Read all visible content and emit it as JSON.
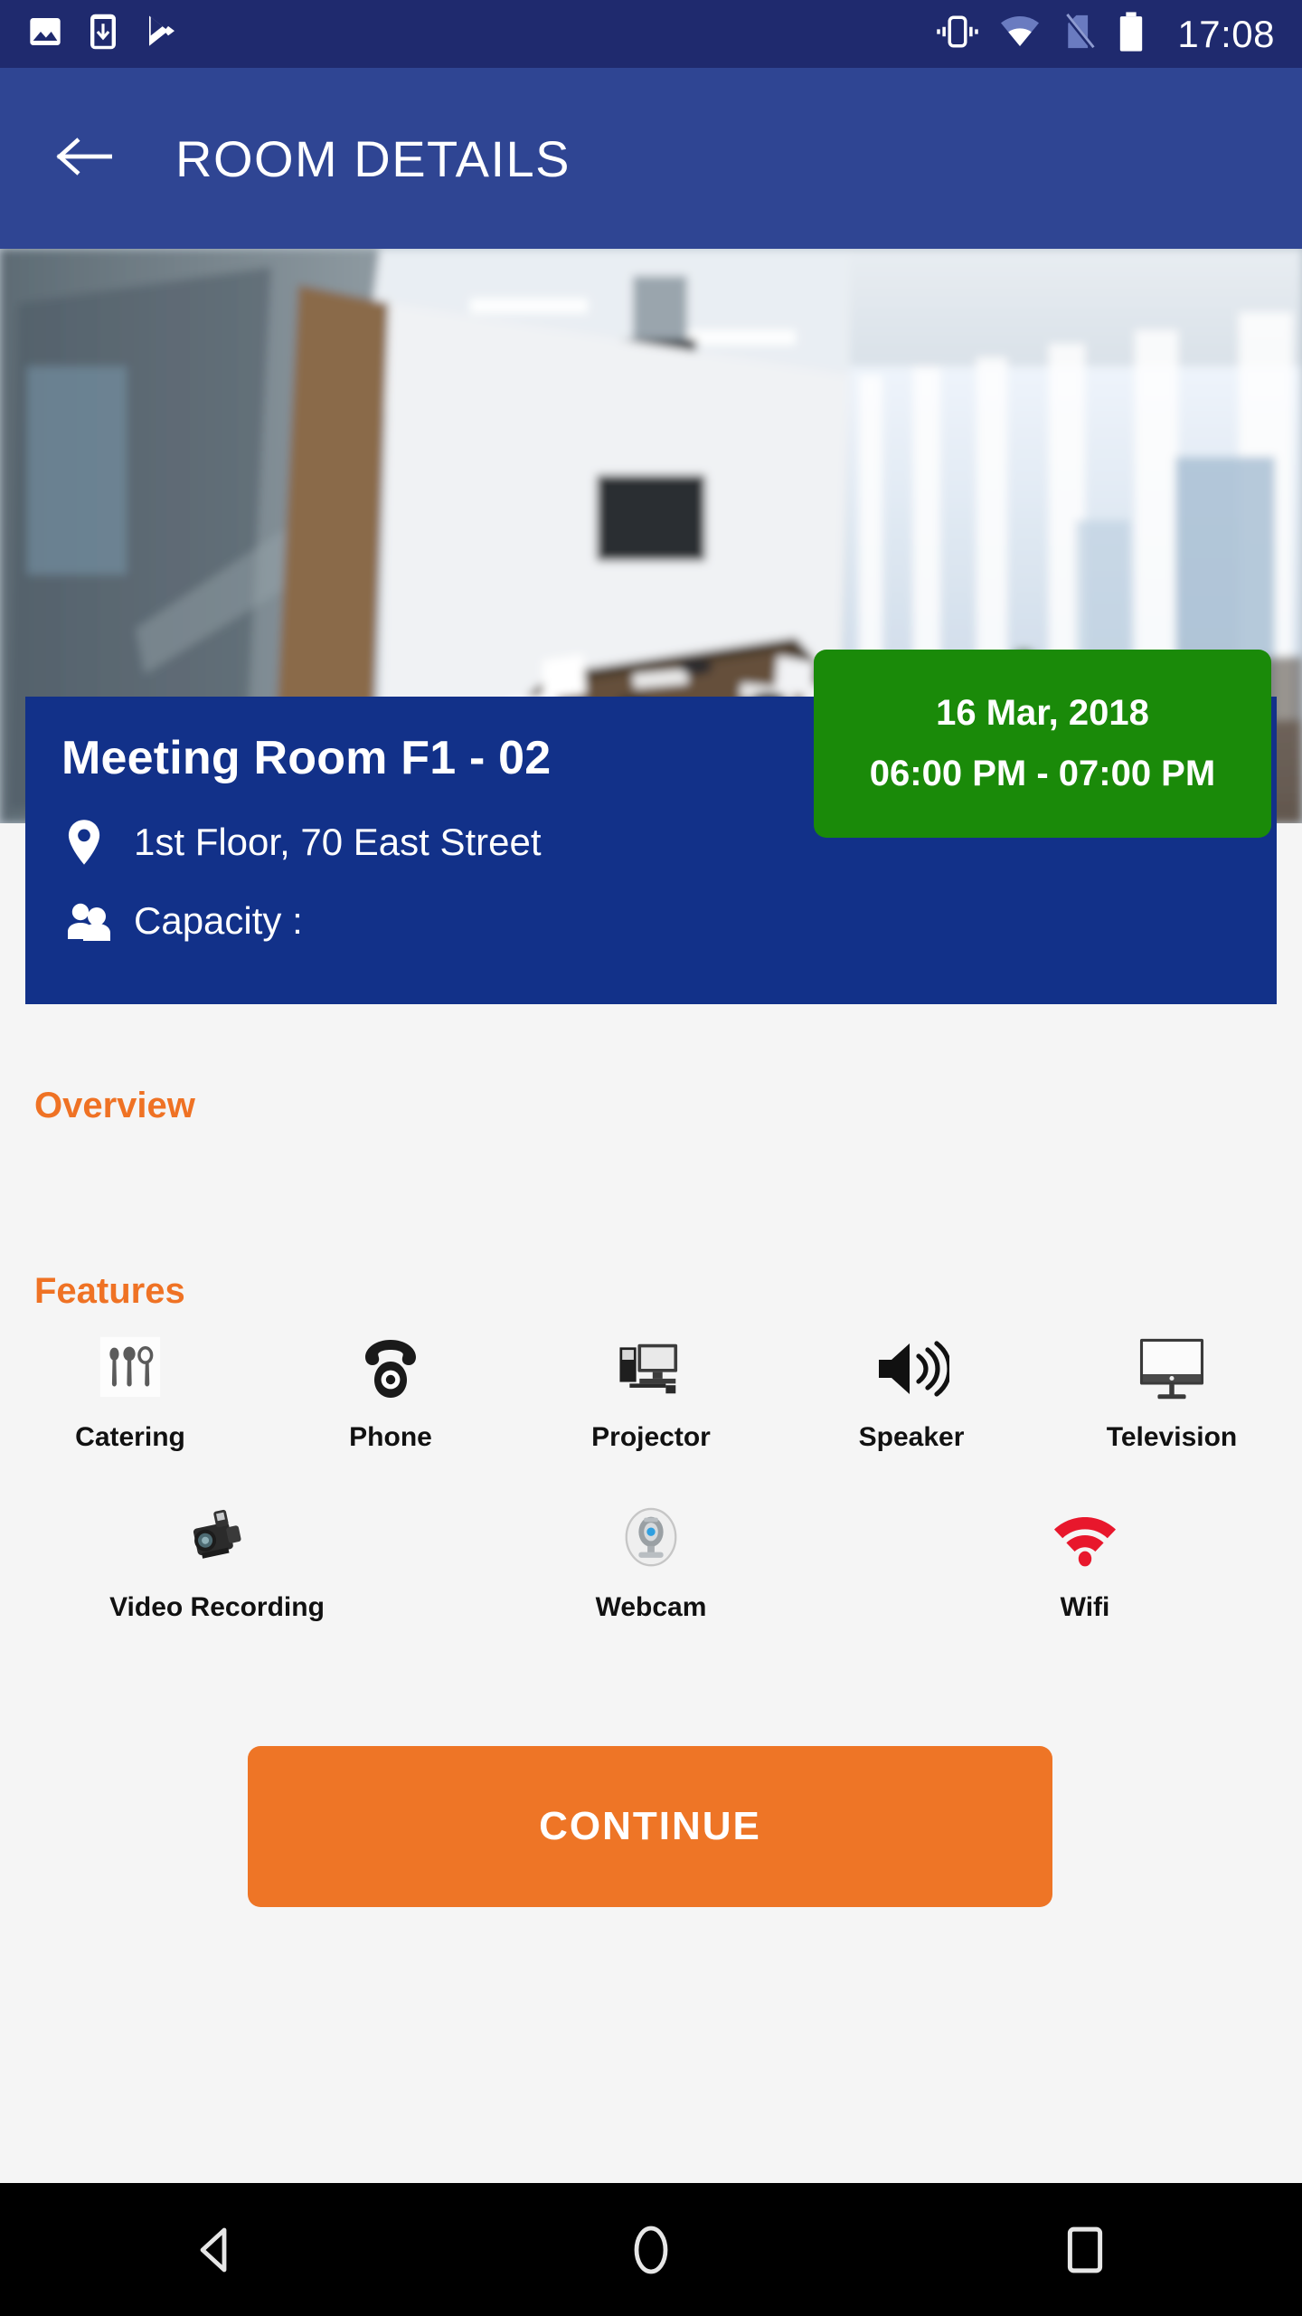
{
  "statusbar": {
    "time": "17:08",
    "left_icons": [
      "image-icon",
      "download-icon",
      "play-store-icon"
    ],
    "right_icons": [
      "vibrate-icon",
      "wifi-icon",
      "no-sim-icon",
      "battery-icon"
    ],
    "background_color": "#1f2a6e"
  },
  "appbar": {
    "back_label": "back-arrow",
    "title": "ROOM DETAILS",
    "background_color": "#2f4593"
  },
  "hero": {
    "alt": "meeting room photo"
  },
  "room": {
    "name": "Meeting Room F1 - 02",
    "location": "1st Floor, 70 East Street",
    "capacity_label": "Capacity :",
    "capacity_value": "",
    "card_color": "#123189"
  },
  "booking": {
    "date": "16 Mar, 2018",
    "time_range": "06:00 PM - 07:00 PM",
    "badge_color": "#1a8a09"
  },
  "sections": {
    "overview_title": "Overview",
    "overview_body": "",
    "features_title": "Features",
    "accent_color": "#ef7224"
  },
  "features": {
    "row1": [
      {
        "label": "Catering",
        "icon": "catering-icon"
      },
      {
        "label": "Phone",
        "icon": "phone-icon"
      },
      {
        "label": "Projector",
        "icon": "projector-icon"
      },
      {
        "label": "Speaker",
        "icon": "speaker-icon"
      },
      {
        "label": "Television",
        "icon": "television-icon"
      }
    ],
    "row2": [
      {
        "label": "Video Recording",
        "icon": "video-camera-icon"
      },
      {
        "label": "Webcam",
        "icon": "webcam-icon"
      },
      {
        "label": "Wifi",
        "icon": "wifi-icon"
      }
    ]
  },
  "actions": {
    "continue_label": "CONTINUE",
    "continue_color": "#ee7526"
  },
  "navbar": {
    "back": "nav-back-icon",
    "home": "nav-home-icon",
    "recents": "nav-recents-icon"
  }
}
